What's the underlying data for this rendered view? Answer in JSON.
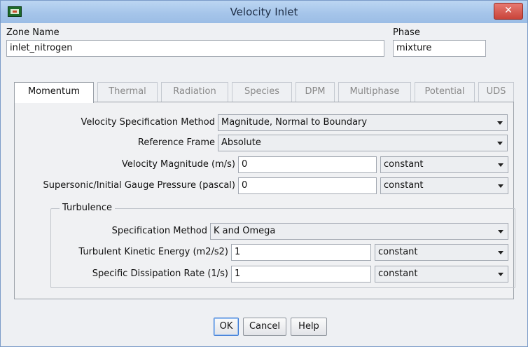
{
  "window": {
    "title": "Velocity Inlet",
    "close_symbol": "✕"
  },
  "zone": {
    "label": "Zone Name",
    "value": "inlet_nitrogen"
  },
  "phase": {
    "label": "Phase",
    "value": "mixture"
  },
  "tabs": [
    "Momentum",
    "Thermal",
    "Radiation",
    "Species",
    "DPM",
    "Multiphase",
    "Potential",
    "UDS"
  ],
  "active_tab": "Momentum",
  "momentum": {
    "velocity_spec": {
      "label": "Velocity Specification Method",
      "value": "Magnitude, Normal to Boundary"
    },
    "reference_frame": {
      "label": "Reference Frame",
      "value": "Absolute"
    },
    "velocity_magnitude": {
      "label": "Velocity Magnitude (m/s)",
      "value": "0",
      "mode": "constant"
    },
    "gauge_pressure": {
      "label": "Supersonic/Initial Gauge Pressure (pascal)",
      "value": "0",
      "mode": "constant"
    },
    "turbulence": {
      "group_label": "Turbulence",
      "spec_method": {
        "label": "Specification Method",
        "value": "K and Omega"
      },
      "kinetic_energy": {
        "label": "Turbulent Kinetic Energy (m2/s2)",
        "value": "1",
        "mode": "constant"
      },
      "dissipation_rate": {
        "label": "Specific Dissipation Rate (1/s)",
        "value": "1",
        "mode": "constant"
      }
    }
  },
  "buttons": {
    "ok": "OK",
    "cancel": "Cancel",
    "help": "Help"
  }
}
